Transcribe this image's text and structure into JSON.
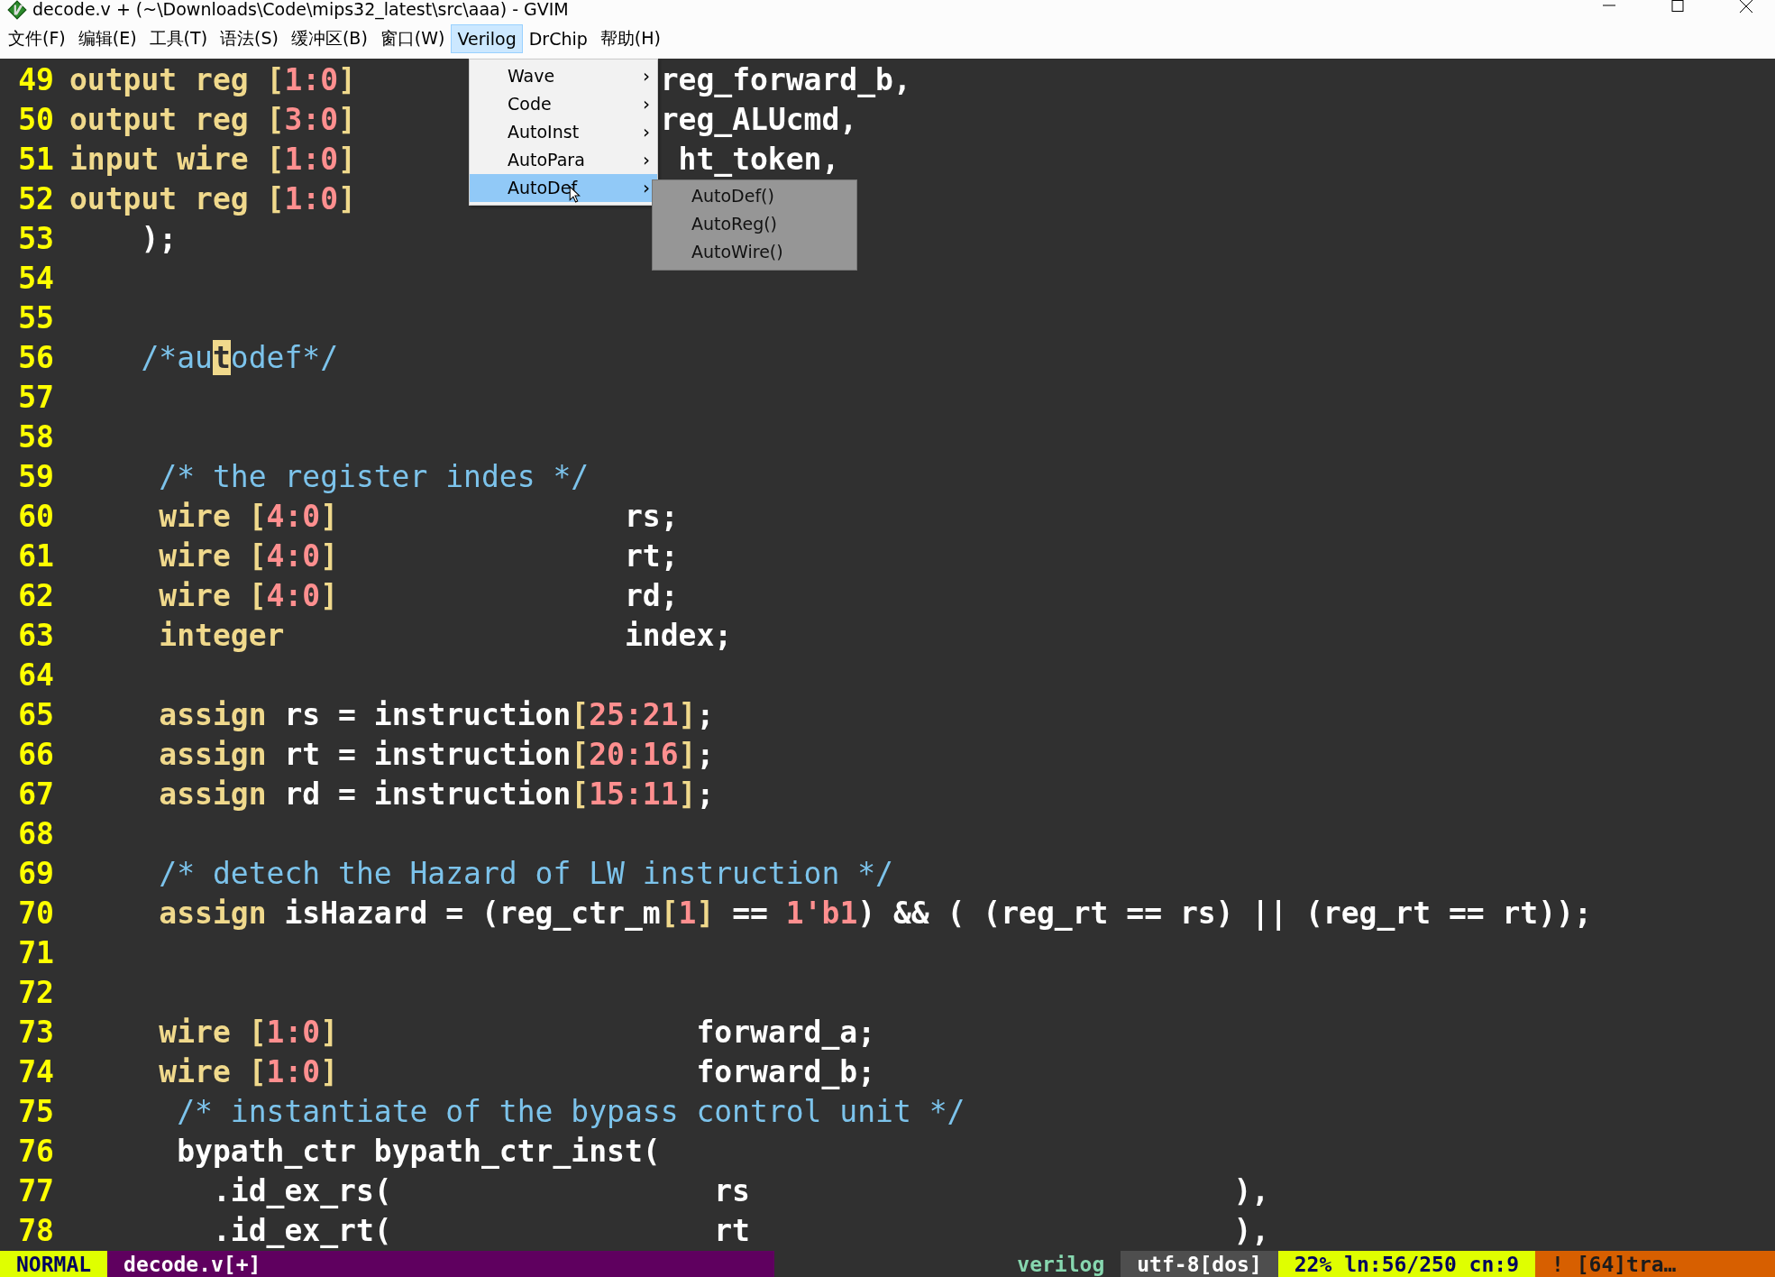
{
  "window": {
    "title": "decode.v + (~\\Downloads\\Code\\mips32_latest\\src\\aaa) - GVIM"
  },
  "menubar": [
    {
      "label": "文件(F)",
      "selected": false
    },
    {
      "label": "编辑(E)",
      "selected": false
    },
    {
      "label": "工具(T)",
      "selected": false
    },
    {
      "label": "语法(S)",
      "selected": false
    },
    {
      "label": "缓冲区(B)",
      "selected": false
    },
    {
      "label": "窗口(W)",
      "selected": false
    },
    {
      "label": "Verilog",
      "selected": true
    },
    {
      "label": "DrChip",
      "selected": false
    },
    {
      "label": "帮助(H)",
      "selected": false
    }
  ],
  "dropdown": [
    {
      "label": "Wave",
      "selected": false,
      "submenu_arrow": "›"
    },
    {
      "label": "Code",
      "selected": false,
      "submenu_arrow": "›"
    },
    {
      "label": "AutoInst",
      "selected": false,
      "submenu_arrow": "›"
    },
    {
      "label": "AutoPara",
      "selected": false,
      "submenu_arrow": "›"
    },
    {
      "label": "AutoDef",
      "selected": true,
      "submenu_arrow": "›"
    }
  ],
  "submenu": [
    "AutoDef()",
    "AutoReg()",
    "AutoWire()"
  ],
  "lines": [
    {
      "number": "49",
      "segments": [
        {
          "kind": "kw",
          "text": "output reg ["
        },
        {
          "kind": "num",
          "text": "1:0"
        },
        {
          "kind": "kw",
          "text": "]"
        },
        {
          "kind": "text",
          "text": "                 reg_forward_b,"
        }
      ]
    },
    {
      "number": "50",
      "segments": [
        {
          "kind": "kw",
          "text": "output reg ["
        },
        {
          "kind": "num",
          "text": "3:0"
        },
        {
          "kind": "kw",
          "text": "]"
        },
        {
          "kind": "text",
          "text": "                 reg_ALUcmd,"
        }
      ]
    },
    {
      "number": "51",
      "segments": [
        {
          "kind": "kw",
          "text": "input wire ["
        },
        {
          "kind": "num",
          "text": "1:0"
        },
        {
          "kind": "kw",
          "text": "]"
        },
        {
          "kind": "text",
          "text": "                  ht_token,"
        }
      ]
    },
    {
      "number": "52",
      "segments": [
        {
          "kind": "kw",
          "text": "output reg ["
        },
        {
          "kind": "num",
          "text": "1:0"
        },
        {
          "kind": "kw",
          "text": "]"
        }
      ]
    },
    {
      "number": "53",
      "segments": [
        {
          "kind": "text",
          "text": "    );"
        }
      ]
    },
    {
      "number": "54"
    },
    {
      "number": "55"
    },
    {
      "number": "56",
      "segments": [
        {
          "kind": "comment",
          "text": "    /*au"
        },
        {
          "kind": "cursor",
          "text": "t"
        },
        {
          "kind": "comment",
          "text": "odef*/"
        }
      ]
    },
    {
      "number": "57"
    },
    {
      "number": "58"
    },
    {
      "number": "59",
      "segments": [
        {
          "kind": "comment",
          "text": "     /* the register indes */"
        }
      ]
    },
    {
      "number": "60",
      "segments": [
        {
          "kind": "kw",
          "text": "     wire ["
        },
        {
          "kind": "num",
          "text": "4:0"
        },
        {
          "kind": "kw",
          "text": "]"
        },
        {
          "kind": "text",
          "text": "                rs;"
        }
      ]
    },
    {
      "number": "61",
      "segments": [
        {
          "kind": "kw",
          "text": "     wire ["
        },
        {
          "kind": "num",
          "text": "4:0"
        },
        {
          "kind": "kw",
          "text": "]"
        },
        {
          "kind": "text",
          "text": "                rt;"
        }
      ]
    },
    {
      "number": "62",
      "segments": [
        {
          "kind": "kw",
          "text": "     wire ["
        },
        {
          "kind": "num",
          "text": "4:0"
        },
        {
          "kind": "kw",
          "text": "]"
        },
        {
          "kind": "text",
          "text": "                rd;"
        }
      ]
    },
    {
      "number": "63",
      "segments": [
        {
          "kind": "kw",
          "text": "     integer"
        },
        {
          "kind": "text",
          "text": "                   index;"
        }
      ]
    },
    {
      "number": "64"
    },
    {
      "number": "65",
      "segments": [
        {
          "kind": "kw",
          "text": "     assign"
        },
        {
          "kind": "text",
          "text": " rs = instruction"
        },
        {
          "kind": "kw",
          "text": "["
        },
        {
          "kind": "num",
          "text": "25:21"
        },
        {
          "kind": "kw",
          "text": "]"
        },
        {
          "kind": "text",
          "text": ";"
        }
      ]
    },
    {
      "number": "66",
      "segments": [
        {
          "kind": "kw",
          "text": "     assign"
        },
        {
          "kind": "text",
          "text": " rt = instruction"
        },
        {
          "kind": "kw",
          "text": "["
        },
        {
          "kind": "num",
          "text": "20:16"
        },
        {
          "kind": "kw",
          "text": "]"
        },
        {
          "kind": "text",
          "text": ";"
        }
      ]
    },
    {
      "number": "67",
      "segments": [
        {
          "kind": "kw",
          "text": "     assign"
        },
        {
          "kind": "text",
          "text": " rd = instruction"
        },
        {
          "kind": "kw",
          "text": "["
        },
        {
          "kind": "num",
          "text": "15:11"
        },
        {
          "kind": "kw",
          "text": "]"
        },
        {
          "kind": "text",
          "text": ";"
        }
      ]
    },
    {
      "number": "68"
    },
    {
      "number": "69",
      "segments": [
        {
          "kind": "comment",
          "text": "     /* detech the Hazard of LW instruction */"
        }
      ]
    },
    {
      "number": "70",
      "segments": [
        {
          "kind": "kw",
          "text": "     assign"
        },
        {
          "kind": "text",
          "text": " isHazard = (reg_ctr_m"
        },
        {
          "kind": "kw",
          "text": "["
        },
        {
          "kind": "num",
          "text": "1"
        },
        {
          "kind": "kw",
          "text": "]"
        },
        {
          "kind": "text",
          "text": " == "
        },
        {
          "kind": "num",
          "text": "1'b1"
        },
        {
          "kind": "text",
          "text": ") && ( (reg_rt == rs) || (reg_rt == rt));"
        }
      ]
    },
    {
      "number": "71"
    },
    {
      "number": "72"
    },
    {
      "number": "73",
      "segments": [
        {
          "kind": "kw",
          "text": "     wire ["
        },
        {
          "kind": "num",
          "text": "1:0"
        },
        {
          "kind": "kw",
          "text": "]"
        },
        {
          "kind": "text",
          "text": "                    forward_a;"
        }
      ]
    },
    {
      "number": "74",
      "segments": [
        {
          "kind": "kw",
          "text": "     wire ["
        },
        {
          "kind": "num",
          "text": "1:0"
        },
        {
          "kind": "kw",
          "text": "]"
        },
        {
          "kind": "text",
          "text": "                    forward_b;"
        }
      ]
    },
    {
      "number": "75",
      "segments": [
        {
          "kind": "comment",
          "text": "      /* instantiate of the bypass control unit */"
        }
      ]
    },
    {
      "number": "76",
      "segments": [
        {
          "kind": "text",
          "text": "      bypath_ctr bypath_ctr_inst("
        }
      ]
    },
    {
      "number": "77",
      "segments": [
        {
          "kind": "text",
          "text": "        .id_ex_rs(                  rs                           ),"
        }
      ]
    },
    {
      "number": "78",
      "segments": [
        {
          "kind": "text",
          "text": "        .id_ex_rt(                  rt                           ),"
        }
      ]
    }
  ],
  "status_bar": [
    {
      "kind": "mode",
      "text": "NORMAL"
    },
    {
      "kind": "file",
      "text": "decode.v[+]"
    },
    {
      "kind": "filetype",
      "text": "verilog"
    },
    {
      "kind": "encoding",
      "text": "utf-8[dos]"
    },
    {
      "kind": "position",
      "text": "22% ln:56/250 cn:9"
    },
    {
      "kind": "warning",
      "text": "! [64]tra…"
    }
  ]
}
